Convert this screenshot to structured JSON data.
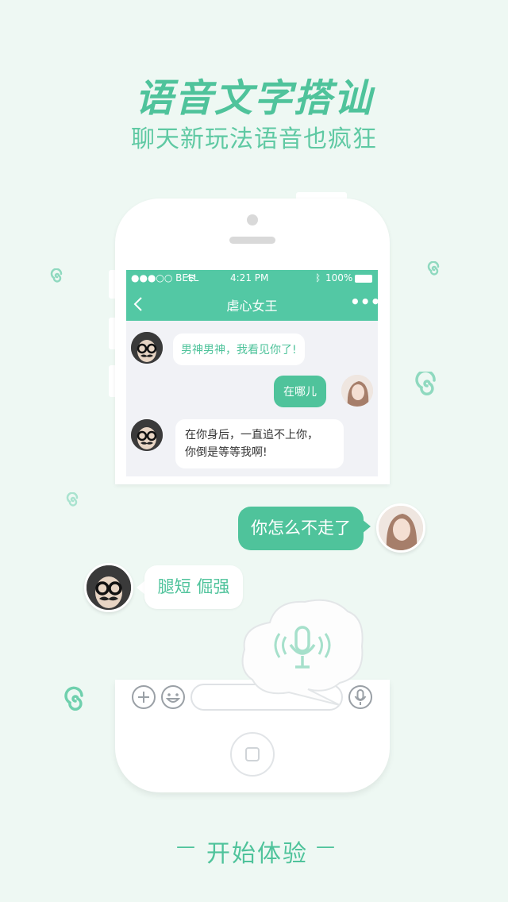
{
  "hero": {
    "title": "语音文字搭讪",
    "subtitle": "聊天新玩法语音也疯狂"
  },
  "status_bar": {
    "carrier": "●●●○○ BELL",
    "time": "4:21 PM",
    "battery": "100%"
  },
  "chat": {
    "title": "虐心女王",
    "more": "•••",
    "messages": [
      {
        "from": "other",
        "text": "男神男神，我看见你了!"
      },
      {
        "from": "me",
        "text": "在哪儿"
      },
      {
        "from": "other",
        "text_line1": "在你身后，一直追不上你，",
        "text_line2": "你倒是等等我啊!"
      }
    ]
  },
  "floating": {
    "message_me": "你怎么不走了",
    "message_other": "腿短 倔强"
  },
  "cta": {
    "label": "开始体验",
    "dash_left": "—",
    "dash_right": "—"
  },
  "colors": {
    "accent": "#4fc39b",
    "background": "#eef8f3",
    "navbar": "#53c8a4"
  }
}
